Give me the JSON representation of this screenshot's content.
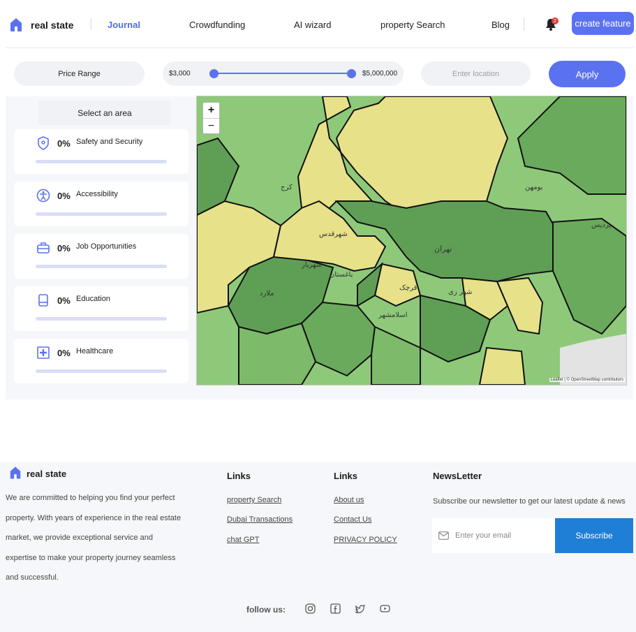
{
  "header": {
    "brand": "real state",
    "nav": [
      {
        "label": "Journal",
        "active": true
      },
      {
        "label": "Crowdfunding"
      },
      {
        "label": "AI wizard"
      },
      {
        "label": "property Search"
      },
      {
        "label": "Blog"
      }
    ],
    "notification_count": "2",
    "create_button": "create feature"
  },
  "filters": {
    "price_range_label": "Price Range",
    "min_price": "$3,000",
    "max_price": "$5,000,000",
    "location_placeholder": "Enter location",
    "apply_label": "Apply"
  },
  "area_panel": {
    "title": "Select an area",
    "items": [
      {
        "label": "Safety and Security",
        "percent": "0%",
        "icon": "shield-icon"
      },
      {
        "label": "Accessibility",
        "percent": "0%",
        "icon": "accessibility-icon"
      },
      {
        "label": "Job Opportunities",
        "percent": "0%",
        "icon": "briefcase-icon"
      },
      {
        "label": "Education",
        "percent": "0%",
        "icon": "book-icon"
      },
      {
        "label": "Healthcare",
        "percent": "0%",
        "icon": "medical-cross-icon"
      }
    ]
  },
  "map": {
    "zoom_in": "+",
    "zoom_out": "−",
    "attribution": "Leaflet | © OpenStreetMap contributors",
    "city_labels": [
      "تهران",
      "شهریار",
      "شهر ری",
      "کرج",
      "باغستان",
      "شهرقدس",
      "قرچک",
      "بومهن",
      "پردیس",
      "اسلامشهر",
      "ملارد"
    ]
  },
  "footer": {
    "brand": "real state",
    "about": "We are committed to helping you find your perfect property. With years of experience in the real estate market, we provide exceptional service and expertise to make your property journey seamless and successful.",
    "links1_title": "Links",
    "links1": [
      "property Search",
      "Dubai Transactions",
      "chat GPT"
    ],
    "links2_title": "Links",
    "links2": [
      "About us",
      "Contact Us",
      "PRIVACY POLICY"
    ],
    "newsletter_title": "NewsLetter",
    "newsletter_text": "Subscribe our newsletter to get our latest update & news",
    "email_placeholder": "Enter your email",
    "subscribe_label": "Subscribe",
    "follow_label": "follow us:"
  },
  "colors": {
    "accent": "#5b72f0",
    "subscribe": "#1f7fd6",
    "map_green": "#7fbf6a",
    "map_yellow": "#e9e38a"
  }
}
